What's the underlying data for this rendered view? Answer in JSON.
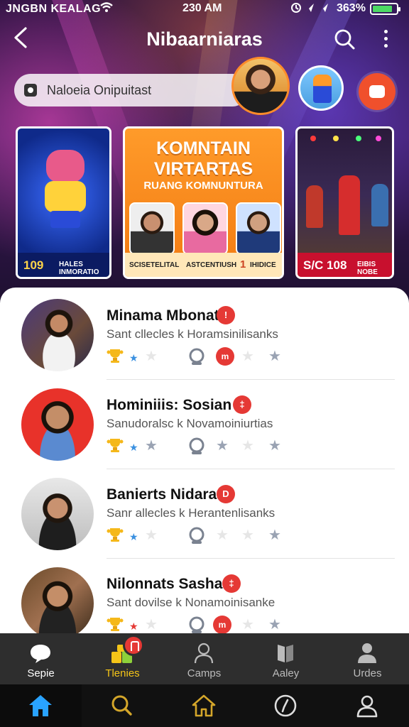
{
  "status_bar": {
    "carrier": "JNGBN KEALAG",
    "time": "230 AM",
    "battery_pct": "363%",
    "battery_level": 0.85,
    "battery_color": "#4cd964"
  },
  "header": {
    "title": "Nibaarniaras",
    "back_icon": "chevron-left-icon",
    "search_icon": "search-icon",
    "more_icon": "more-vertical-icon"
  },
  "search": {
    "text": "Naloeia Onipuitast"
  },
  "featured_cards": [
    {
      "number": "109",
      "label_line1": "HALES",
      "label_line2": "INMORATIO"
    },
    {
      "title_line1": "KOMNTAIN",
      "title_line2": "VIRTARTAS",
      "subtitle": "RUANG KOMNUNTURA",
      "left_label": "SCISETELITAL",
      "mid_label": "ASTCENTIUSH",
      "number": "1",
      "right_label": "IHIDICE"
    },
    {
      "number": "S/C 108",
      "label_line1": "EIBIS",
      "label_line2": "NOBE"
    }
  ],
  "list_rows": [
    {
      "name": "Minama Mbonat",
      "subtitle": "Sant cllecles k Horamsinilisanks",
      "badge": "!"
    },
    {
      "name": "Hominiiis: Sosian",
      "subtitle": "Sanudoralsc k Novamoiniurtias",
      "badge": "‡"
    },
    {
      "name": "Banierts Nidarat",
      "subtitle": "Sanr allecles k Herantenlisanks",
      "badge": "D"
    },
    {
      "name": "Nilonnats Sashari",
      "subtitle": "Sant dovilse k Nonamoinisanke",
      "badge": "‡"
    }
  ],
  "tabs": [
    {
      "label": "Sepie",
      "icon": "chat-bubble-icon"
    },
    {
      "label": "Tlenies",
      "icon": "blocks-icon"
    },
    {
      "label": "Camps",
      "icon": "person-icon"
    },
    {
      "label": "Aaley",
      "icon": "book-icon"
    },
    {
      "label": "Urdes",
      "icon": "user-icon"
    }
  ],
  "nav": [
    {
      "icon": "home-icon"
    },
    {
      "icon": "search-icon"
    },
    {
      "icon": "house-outline-icon"
    },
    {
      "icon": "compass-icon"
    },
    {
      "icon": "profile-icon"
    }
  ],
  "colors": {
    "accent_orange": "#f0502c",
    "tab_active": "#f5c518",
    "badge_red": "#e53935",
    "home_blue": "#29a3ff"
  }
}
